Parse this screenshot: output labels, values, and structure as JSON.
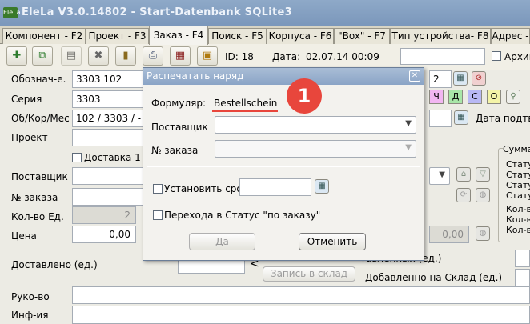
{
  "app": {
    "logo_text": "EleLa",
    "title": "EleLa V3.0.14802  -  Start-Datenbank SQLite3"
  },
  "tabs": [
    {
      "label": "Компонент - F2"
    },
    {
      "label": "Проект - F3"
    },
    {
      "label": "Заказ - F4"
    },
    {
      "label": "Поиск - F5"
    },
    {
      "label": "Корпуса - F6"
    },
    {
      "label": "\"Box\" - F7"
    },
    {
      "label": "Тип устройства- F8"
    },
    {
      "label": "Адрес -"
    }
  ],
  "toolbar": {
    "id_label": "ID: 18",
    "date_label": "Дата:",
    "date_value": "02.07.14 00:09",
    "archive_label": "Архив"
  },
  "form": {
    "oboznach_label": "Обознач-е.",
    "oboznach_value": "3303 102",
    "seriya_label": "Серия",
    "seriya_value": "3303",
    "obkor_label": "Об/Кор/Мес",
    "obkor_value": "102 / 3303 / -",
    "proekt_label": "Проект",
    "count_value": "2",
    "confirm_label": "Дата подтв",
    "dostavka_label": "Доставка 1",
    "postavshik_label": "Поставщик",
    "nomer_label": "№ заказа",
    "kolvo_label": "Кол-во Ед.",
    "kolvo_value": "2",
    "cena_label": "Цена",
    "cena_value": "0,00",
    "right_price_value": "0,00",
    "dostavleno_label": "Доставлено (ед.)",
    "lt_sign": "<",
    "sklad_button": "Запись в склад",
    "dostavlennyh_label": "тавленных (ед.)",
    "dobavleno_label": "Добавленно на Склад (ед.)",
    "rukovo_label": "Руко-во",
    "infiya_label": "Инф-ия",
    "summary_title": "Сумма",
    "summary_rows": [
      "Стату",
      "Стату",
      "Стату",
      "Стату",
      "Кол-во",
      "Кол-во",
      "Кол-во"
    ],
    "color_buttons": [
      {
        "label": "Ч",
        "color": "#f2b6f2"
      },
      {
        "label": "Д",
        "color": "#a8e6a8"
      },
      {
        "label": "С",
        "color": "#b8b8f4"
      },
      {
        "label": "О",
        "color": "#f4f4a8"
      }
    ]
  },
  "modal": {
    "title": "Распечатать наряд",
    "formular_label": "Формуляр:",
    "formular_value": "Bestellschein",
    "postavshik_label": "Поставщик",
    "postavshik_value": "",
    "nomer_label": "№ заказа",
    "nomer_value": "",
    "set_deadline_label": "Установить срок",
    "status_label": "Перехода в Статус \"по заказу\"",
    "ok_button": "Да",
    "cancel_button": "Отменить"
  },
  "annotation": {
    "badge_number": "1",
    "color": "#e8463c"
  }
}
